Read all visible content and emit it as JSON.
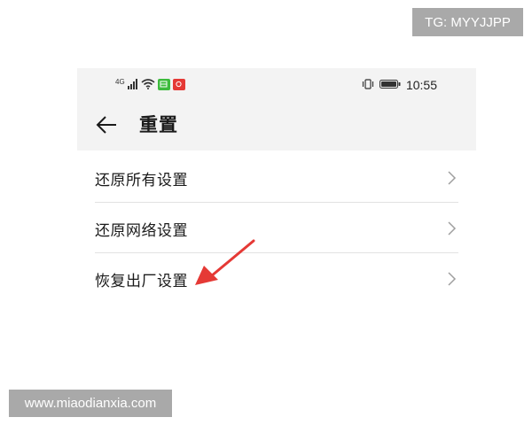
{
  "watermark_top": "TG: MYYJJPP",
  "watermark_bottom": "www.miaodianxia.com",
  "status_bar": {
    "network_label": "4G",
    "time": "10:55",
    "colors": {
      "green_badge": "#3dbb3d",
      "red_badge": "#e53935"
    }
  },
  "header": {
    "title": "重置",
    "back_icon": "arrow-left-icon"
  },
  "items": [
    {
      "label": "还原所有设置",
      "icon": "chevron-right-icon"
    },
    {
      "label": "还原网络设置",
      "icon": "chevron-right-icon"
    },
    {
      "label": "恢复出厂设置",
      "icon": "chevron-right-icon"
    }
  ],
  "annotation": {
    "icon": "red-pointer-arrow",
    "color": "#e53935"
  }
}
